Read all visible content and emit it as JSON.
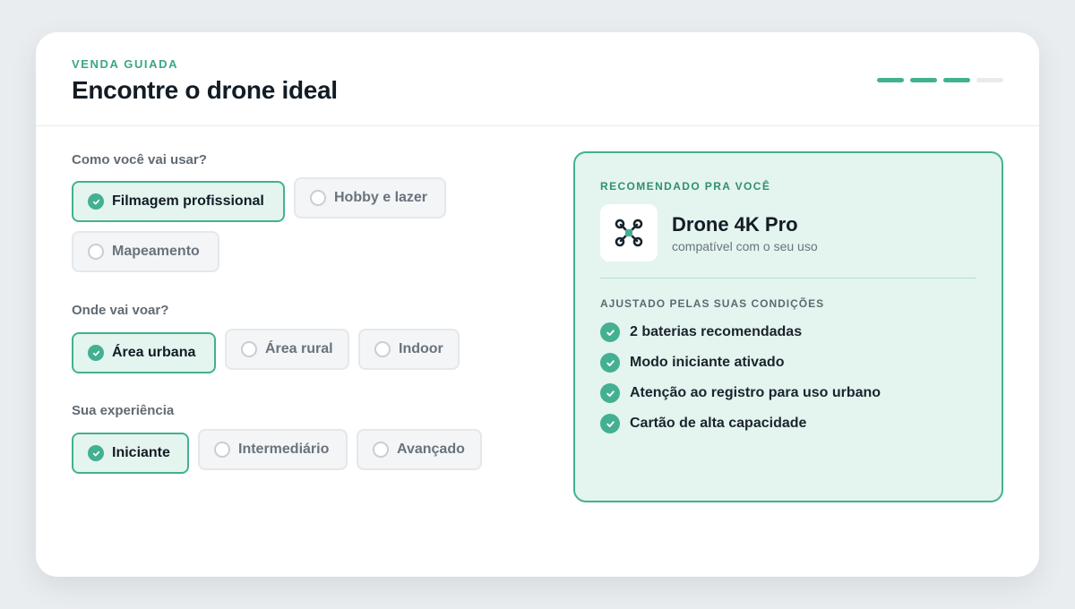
{
  "header": {
    "eyebrow": "VENDA GUIADA",
    "title": "Encontre o drone ideal",
    "progress": {
      "completed_steps": 3,
      "total_steps": 4
    }
  },
  "questions": [
    {
      "label": "Como você vai usar?",
      "options": [
        {
          "label": "Filmagem profissional",
          "selected": true
        },
        {
          "label": "Hobby e lazer",
          "selected": false
        },
        {
          "label": "Mapeamento",
          "selected": false
        }
      ]
    },
    {
      "label": "Onde vai voar?",
      "options": [
        {
          "label": "Área urbana",
          "selected": true
        },
        {
          "label": "Área rural",
          "selected": false
        },
        {
          "label": "Indoor",
          "selected": false
        }
      ]
    },
    {
      "label": "Sua experiência",
      "options": [
        {
          "label": "Iniciante",
          "selected": true
        },
        {
          "label": "Intermediário",
          "selected": false
        },
        {
          "label": "Avançado",
          "selected": false
        }
      ]
    }
  ],
  "recommendation": {
    "eyebrow": "RECOMENDADO PRA VOCÊ",
    "icon": "drone-icon",
    "product_name": "Drone 4K Pro",
    "product_subtitle": "compatível com o seu uso",
    "adjustments_title": "AJUSTADO PELAS SUAS CONDIÇÕES",
    "adjustments": [
      "2 baterias recomendadas",
      "Modo iniciante ativado",
      "Atenção ao registro para uso urbano",
      "Cartão de alta capacidade"
    ]
  },
  "colors": {
    "accent": "#43b092",
    "accent_light": "#e4f4ef",
    "page_background": "#eaedf0"
  }
}
